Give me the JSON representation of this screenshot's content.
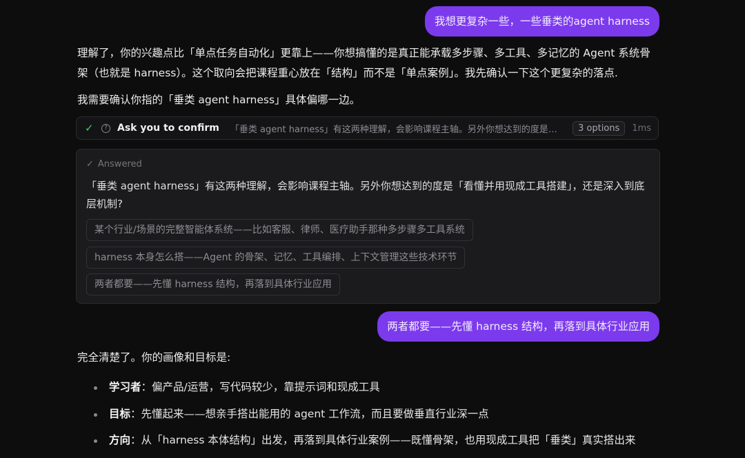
{
  "messages": {
    "user1": "我想更复杂一些，一些垂类的agent harness",
    "assistant1_p1": "理解了，你的兴趣点比「单点任务自动化」更靠上——你想搞懂的是真正能承载多步骤、多工具、多记忆的 Agent 系统骨架（也就是 harness）。这个取向会把课程重心放在「结构」而不是「单点案例」。我先确认一下这个更复杂的落点.",
    "assistant1_p2": "我需要确认你指的「垂类 agent harness」具体偏哪一边。",
    "user2": "两者都要——先懂 harness 结构，再落到具体行业应用",
    "assistant2_intro": "完全清楚了。你的画像和目标是:"
  },
  "tool_call": {
    "name": "Ask you to confirm",
    "preview": "「垂类 agent harness」有这两种理解，会影响课程主轴。另外你想达到的度是「看…",
    "options_badge": "3 options",
    "duration": "1ms"
  },
  "answer_card": {
    "status": "Answered",
    "question": "「垂类 agent harness」有这两种理解，会影响课程主轴。另外你想达到的度是「看懂并用现成工具搭建」，还是深入到底层机制?",
    "options": [
      "某个行业/场景的完整智能体系统——比如客服、律师、医疗助手那种多步骤多工具系统",
      "harness 本身怎么搭——Agent 的骨架、记忆、工具编排、上下文管理这些技术环节",
      "两者都要——先懂 harness 结构，再落到具体行业应用"
    ]
  },
  "profile": [
    {
      "label": "学习者",
      "text": "：偏产品/运营，写代码较少，靠提示词和现成工具"
    },
    {
      "label": "目标",
      "text": "：先懂起来——想亲手搭出能用的 agent 工作流，而且要做垂直行业深一点"
    },
    {
      "label": "方向",
      "text": "：从「harness 本体结构」出发，再落到具体行业案例——既懂骨架，也用现成工具把「垂类」真实搭出来"
    }
  ],
  "colors": {
    "user_bubble": "#7c3aed",
    "check_green": "#3ecf72"
  }
}
